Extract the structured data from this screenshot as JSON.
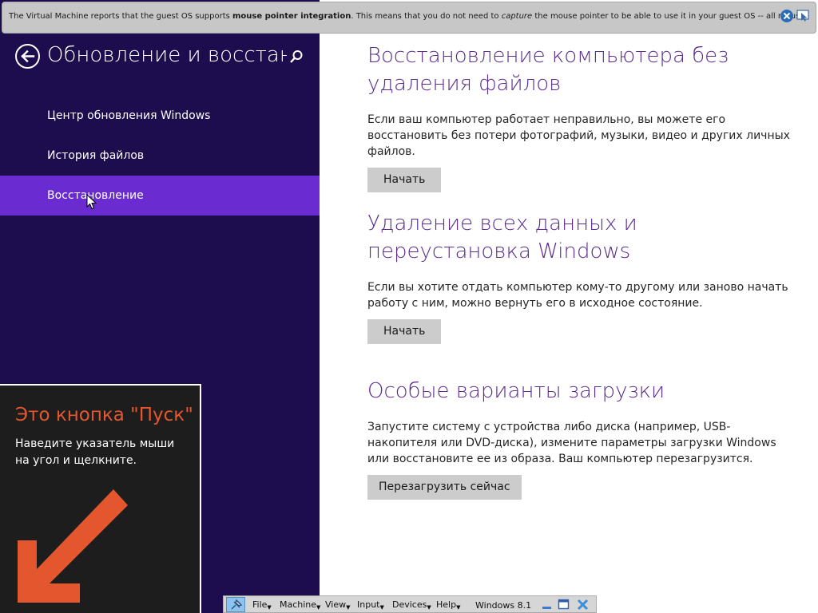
{
  "vm_notification": {
    "text_1": "The Virtual Machine reports that the guest OS supports ",
    "text_bold": "mouse pointer integration",
    "text_2": ". This means that you do not need to ",
    "text_italic": "capture",
    "text_3": " the mouse pointer to be able to use it in your guest OS -- all mouse",
    "icons": [
      "close-icon",
      "mouse-integration-icon"
    ]
  },
  "sidebar": {
    "title": "Обновление и восстан...",
    "items": [
      {
        "label": "Центр обновления Windows",
        "selected": false
      },
      {
        "label": "История файлов",
        "selected": false
      },
      {
        "label": "Восстановление",
        "selected": true
      }
    ],
    "icons": [
      "back-arrow-icon",
      "search-icon"
    ]
  },
  "start_tip": {
    "title": "Это кнопка \"Пуск\"",
    "text": "Наведите указатель мыши на угол и щелкните."
  },
  "main": {
    "sections": [
      {
        "title": "Восстановление компьютера без удаления файлов",
        "description": "Если ваш компьютер работает неправильно, вы можете его восстановить без потери фотографий, музыки, видео и других личных файлов.",
        "button": "Начать"
      },
      {
        "title": "Удаление всех данных и переустановка Windows",
        "description": "Если вы хотите отдать компьютер кому-то другому или заново начать работу с ним, можно вернуть его в исходное состояние.",
        "button": "Начать"
      },
      {
        "title": "Особые варианты загрузки",
        "description": "Запустите систему с устройства либо диска (например, USB-накопителя или DVD-диска), измените параметры загрузки Windows или восстановите ее из образа. Ваш компьютер перезагрузится.",
        "button": "Перезагрузить сейчас"
      }
    ]
  },
  "vm_toolbar": {
    "menus": [
      "File",
      "Machine",
      "View",
      "Input",
      "Devices",
      "Help"
    ],
    "machine_name": "Windows 8.1",
    "icons": [
      "pin-icon",
      "minimize-icon",
      "restore-icon",
      "close-icon"
    ]
  },
  "colors": {
    "sidebar_bg": "#1e0d4e",
    "selected_item": "#6a2bd0",
    "heading": "#5c2d91",
    "start_tip_title": "#e4572e",
    "start_tip_arrow": "#e4572e"
  }
}
